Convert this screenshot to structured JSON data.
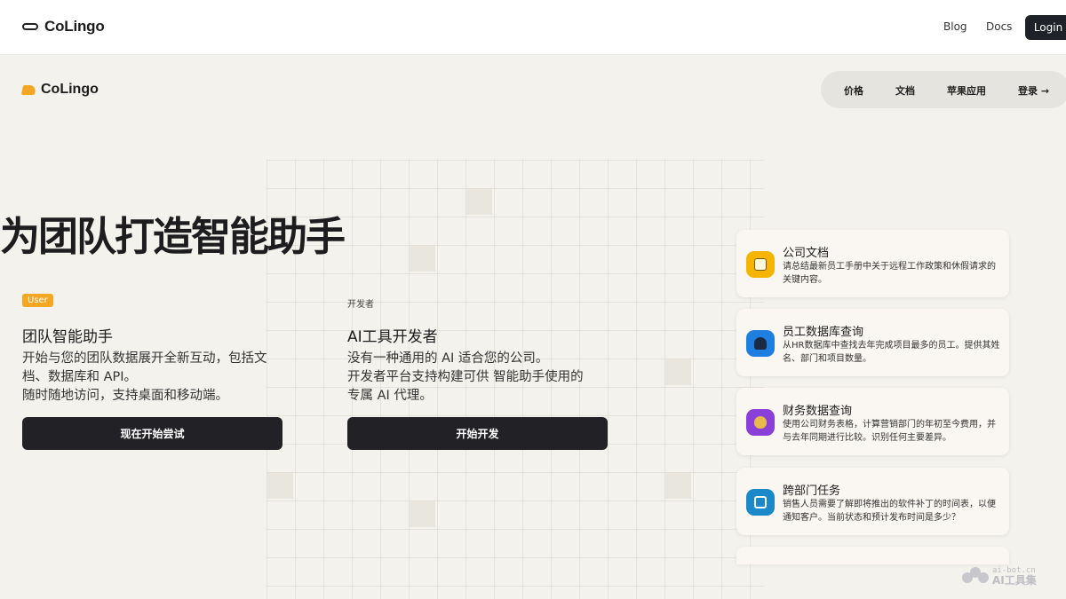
{
  "topbar": {
    "brand": "CoLingo",
    "links": [
      "Blog",
      "Docs"
    ],
    "login": "Login"
  },
  "header": {
    "brand": "CoLingo",
    "nav": [
      "价格",
      "文档",
      "苹果应用",
      "登录 →"
    ]
  },
  "hero": {
    "title": "为团队打造智能助手"
  },
  "user_col": {
    "badge": "User",
    "title": "团队智能助手",
    "desc_lines": [
      "开始与您的团队数据展开全新互动，包括文",
      "档、数据库和 API。",
      "随时随地访问，支持桌面和移动端。"
    ],
    "cta": "现在开始尝试"
  },
  "dev_col": {
    "label": "开发者",
    "title": "AI工具开发者",
    "desc_lines": [
      "没有一种通用的 AI 适合您的公司。",
      "开发者平台支持构建可供 智能助手使用的",
      "专属 AI 代理。"
    ],
    "cta": "开始开发"
  },
  "cards": [
    {
      "title": "公司文档",
      "desc": "请总结最新员工手册中关于远程工作政策和休假请求的关键内容。",
      "icon": "document-icon",
      "color": "#f5b400"
    },
    {
      "title": "员工数据库查询",
      "desc": "从HR数据库中查找去年完成项目最多的员工。提供其姓名、部门和项目数量。",
      "icon": "people-icon",
      "color": "#1f7fe0"
    },
    {
      "title": "财务数据查询",
      "desc": "使用公司财务表格，计算营销部门的年初至今费用，并与去年同期进行比较。识别任何主要差异。",
      "icon": "money-bag-icon",
      "color": "#8b3fd9"
    },
    {
      "title": "跨部门任务",
      "desc": "销售人员需要了解即将推出的软件补丁的时间表，以便通知客户。当前状态和预计发布时间是多少？",
      "icon": "sync-icon",
      "color": "#1a88c9"
    }
  ],
  "watermark": {
    "url": "ai-bot.cn",
    "name": "AI工具集"
  }
}
